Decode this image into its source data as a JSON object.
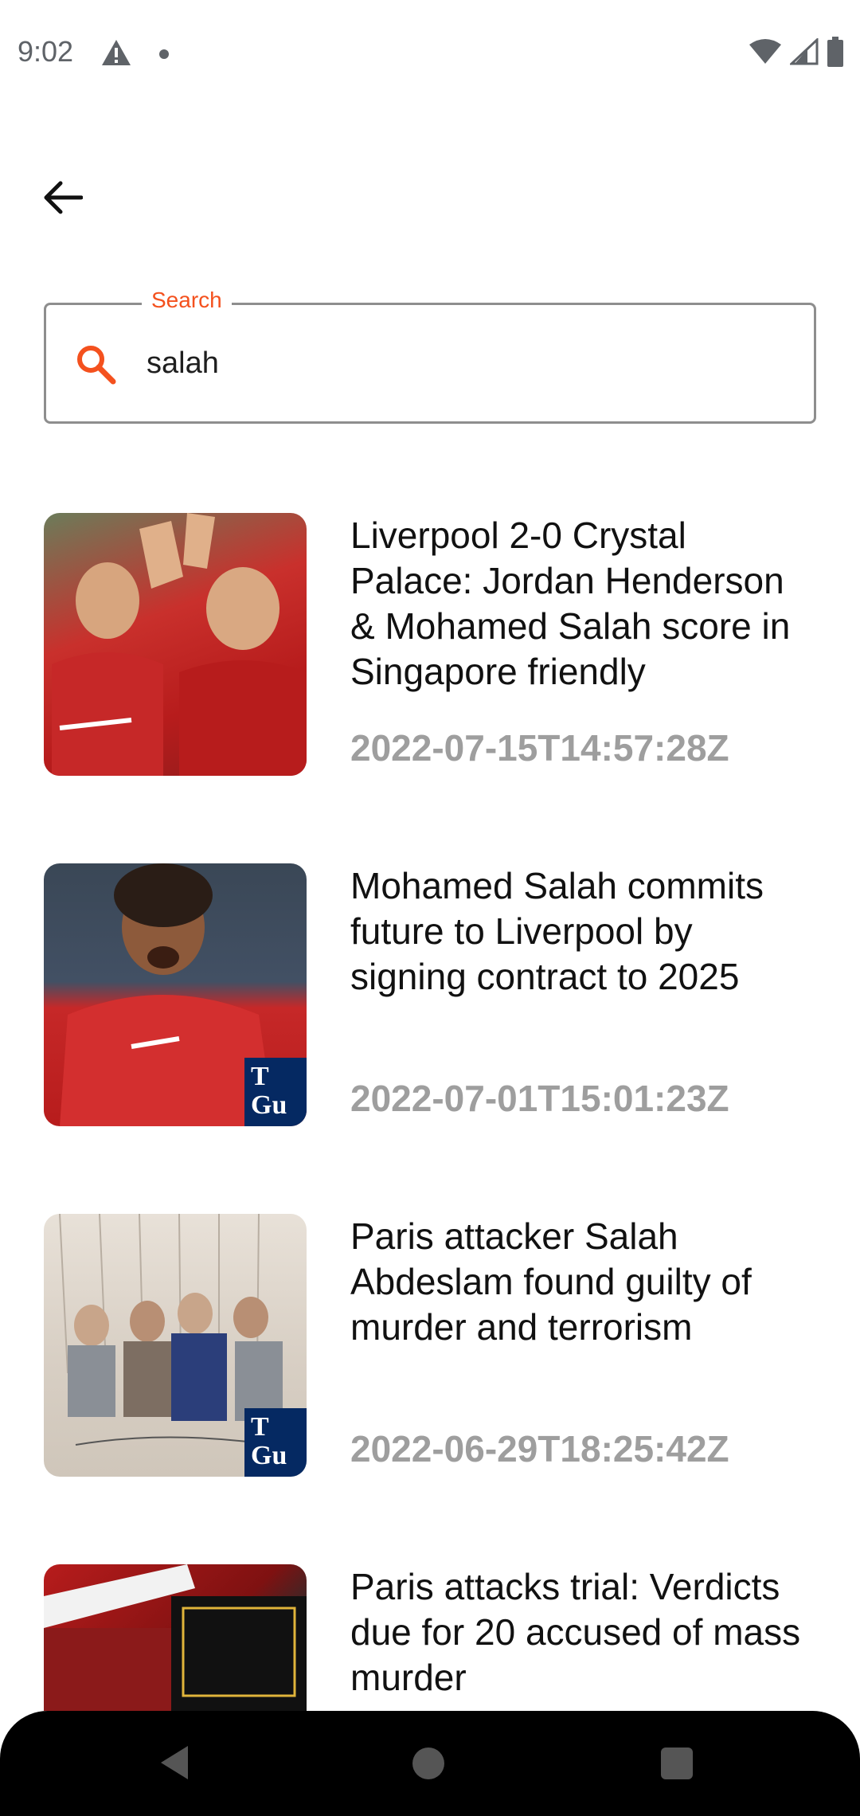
{
  "status_bar": {
    "time": "9:02"
  },
  "search": {
    "label": "Search",
    "value": "salah",
    "accent_color": "#f4511e"
  },
  "articles": [
    {
      "title": "Liverpool 2-0 Crystal Palace: Jordan Henderson & Mohamed Salah score in Singapore friendly",
      "date": "2022-07-15T14:57:28Z"
    },
    {
      "title": "Mohamed Salah commits future to Liverpool by signing contract to 2025",
      "date": "2022-07-01T15:01:23Z",
      "badge": "The Guardian"
    },
    {
      "title": "Paris attacker Salah Abdeslam found guilty of murder and terrorism",
      "date": "2022-06-29T18:25:42Z",
      "badge": "The Guardian"
    },
    {
      "title": "Paris attacks trial: Verdicts due for 20 accused of mass murder",
      "date": ""
    }
  ],
  "icons": {
    "back": "arrow-left-icon",
    "search": "magnifier-icon",
    "status_warning": "warning-icon",
    "wifi": "wifi-icon",
    "signal": "signal-icon",
    "battery": "battery-icon"
  }
}
